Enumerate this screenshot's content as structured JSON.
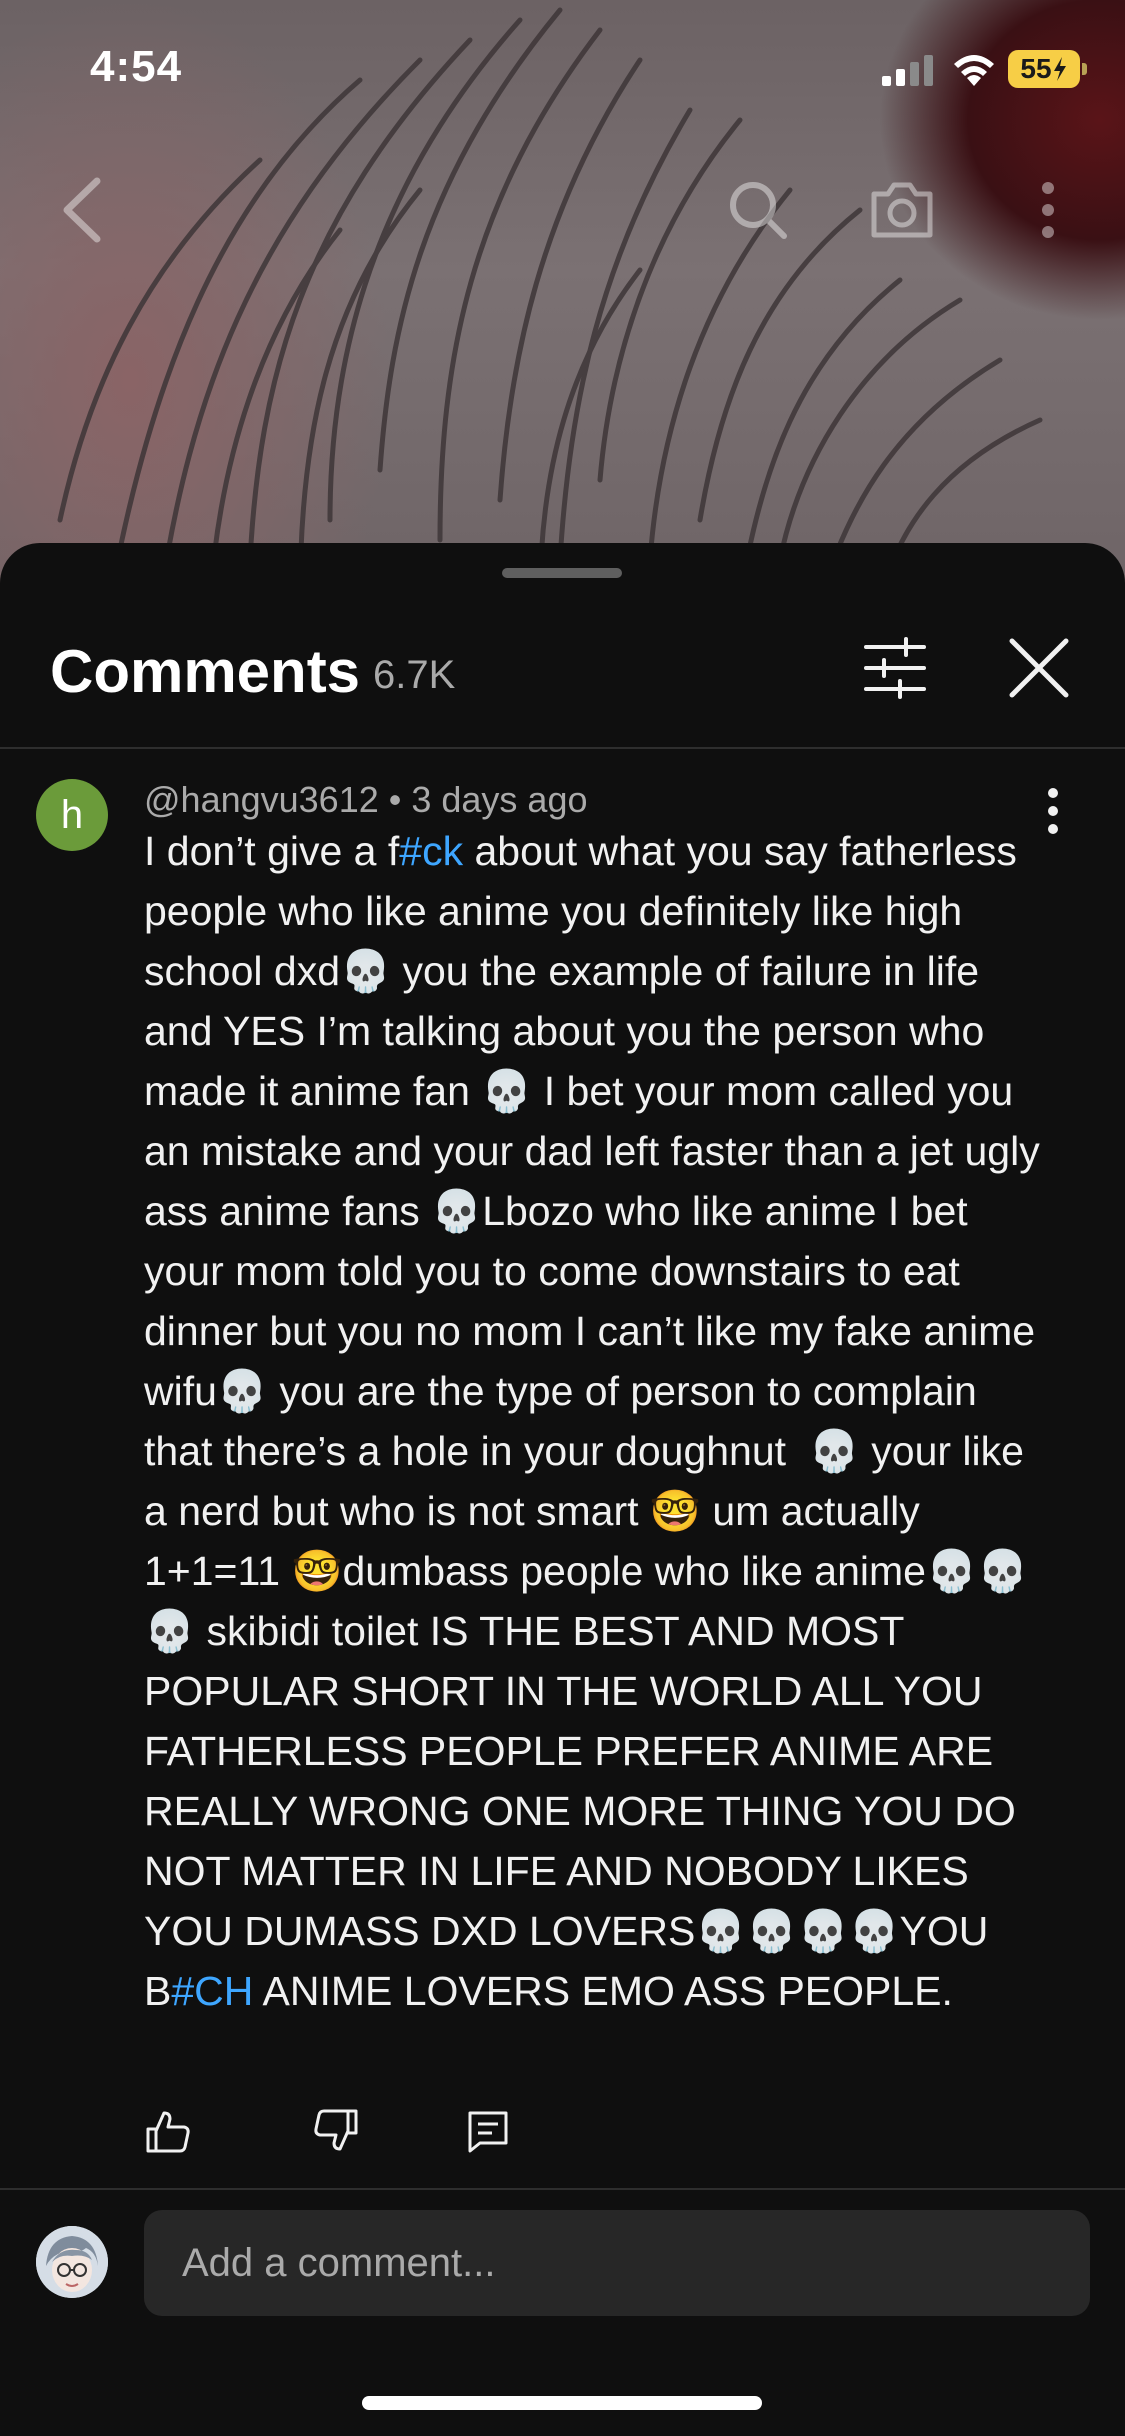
{
  "status_bar": {
    "time": "4:54",
    "battery": "55"
  },
  "comments_sheet": {
    "title": "Comments",
    "count": "6.7K"
  },
  "comment": {
    "author": "@hangvu3612",
    "age": "3 days ago",
    "meta_separator": " • ",
    "avatar_letter": "h",
    "avatar_color": "#6b9b3a",
    "segments": [
      {
        "text": "I don’t give a f",
        "link": false
      },
      {
        "text": "#ck",
        "link": true
      },
      {
        "text": " about what you say fatherless people who like anime you definitely like high school dxd💀 you the example of failure in life and YES I’m talking about you the person who made it anime fan 💀 I bet your mom called you an mistake and your dad left faster than a jet ugly ass anime fans 💀Lbozo who like anime I bet your mom told you to come downstairs to eat dinner but you no mom I can’t like my fake anime wifu💀 you are the type of person to complain that there’s a hole in your doughnut  💀 your like a nerd but who is not smart 🤓 um actually 1+1=11 🤓dumbass people who like anime💀💀 💀 skibidi toilet IS THE BEST AND MOST POPULAR SHORT IN THE WORLD ALL YOU FATHERLESS PEOPLE PREFER ANIME ARE REALLY WRONG ONE MORE THING YOU DO NOT MATTER IN LIFE AND NOBODY LIKES YOU DUMASS DXD LOVERS💀💀💀💀YOU B",
        "link": false
      },
      {
        "text": "#CH",
        "link": true
      },
      {
        "text": " ANIME LOVERS EMO ASS PEOPLE.",
        "link": false
      }
    ]
  },
  "composer": {
    "placeholder": "Add a comment..."
  },
  "colors": {
    "background": "#0f0f0f",
    "link": "#3ea6ff",
    "battery": "#f7ce46"
  },
  "icons": [
    "back-arrow-icon",
    "search-icon",
    "camera-icon",
    "more-vert-icon",
    "filter-icon",
    "close-icon",
    "thumbs-up-icon",
    "thumbs-down-icon",
    "reply-icon"
  ]
}
